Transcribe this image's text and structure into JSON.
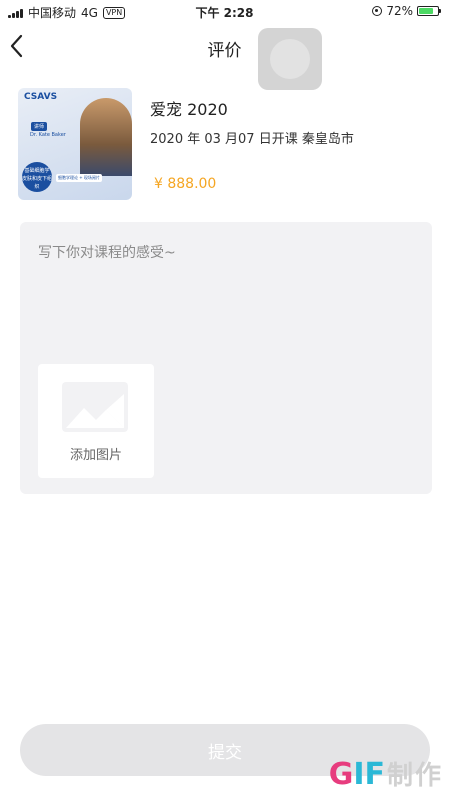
{
  "status_bar": {
    "carrier": "中国移动",
    "network": "4G",
    "vpn": "VPN",
    "time": "下午 2:28",
    "battery": "72%"
  },
  "nav": {
    "title": "评价"
  },
  "course": {
    "title": "爱宠 2020",
    "meta": "2020 年 03 月07 日开课  秦皇岛市",
    "price": "¥ 888.00",
    "image": {
      "brand": "CSAVS",
      "badge": "讲师",
      "lecturer": "Dr. Kate Baker",
      "circle_text": "基础细胞学 皮肤和皮下组织",
      "tag": "细胞学理论 + 现场阅片"
    }
  },
  "review": {
    "placeholder": "写下你对课程的感受~",
    "add_image_label": "添加图片"
  },
  "submit": {
    "label": "提交"
  },
  "watermark": {
    "g": "G",
    "if": "IF",
    "cn": "制作"
  },
  "colors": {
    "price": "#f5a623",
    "review_bg": "#f2f2f4",
    "submit_bg": "#e4e4e6"
  }
}
